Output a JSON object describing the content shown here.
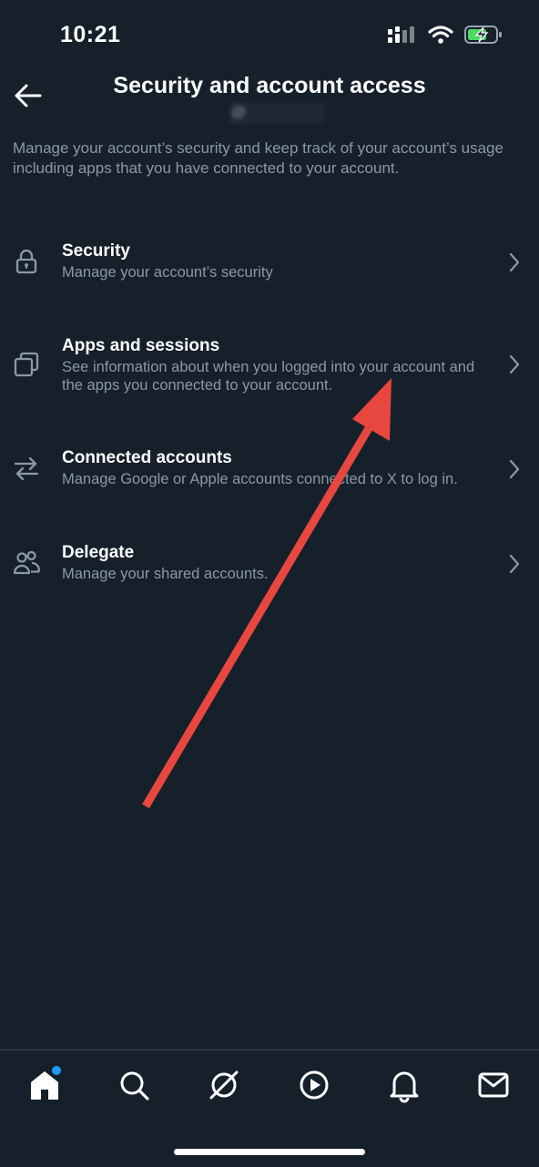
{
  "status_bar": {
    "time": "10:21"
  },
  "header": {
    "title": "Security and account access",
    "handle": "@"
  },
  "description": "Manage your account’s security and keep track of your account’s usage including apps that you have connected to your account.",
  "menu": [
    {
      "label": "Security",
      "sub": "Manage your account’s security",
      "icon": "lock-icon"
    },
    {
      "label": "Apps and sessions",
      "sub": "See information about when you logged into your account and the apps you connected to your account.",
      "icon": "apps-icon"
    },
    {
      "label": "Connected accounts",
      "sub": "Manage Google or Apple accounts connected to X to log in.",
      "icon": "swap-arrows-icon"
    },
    {
      "label": "Delegate",
      "sub": "Manage your shared accounts.",
      "icon": "people-icon"
    }
  ],
  "tab_bar": {
    "tabs": [
      "home",
      "search",
      "grok",
      "video",
      "notifications",
      "messages"
    ],
    "active": "home",
    "home_has_badge": true
  },
  "colors": {
    "background": "#15202b",
    "secondary_text": "#8b98a5",
    "accent": "#1d9bf0",
    "annotation_arrow": "#e8473f"
  }
}
